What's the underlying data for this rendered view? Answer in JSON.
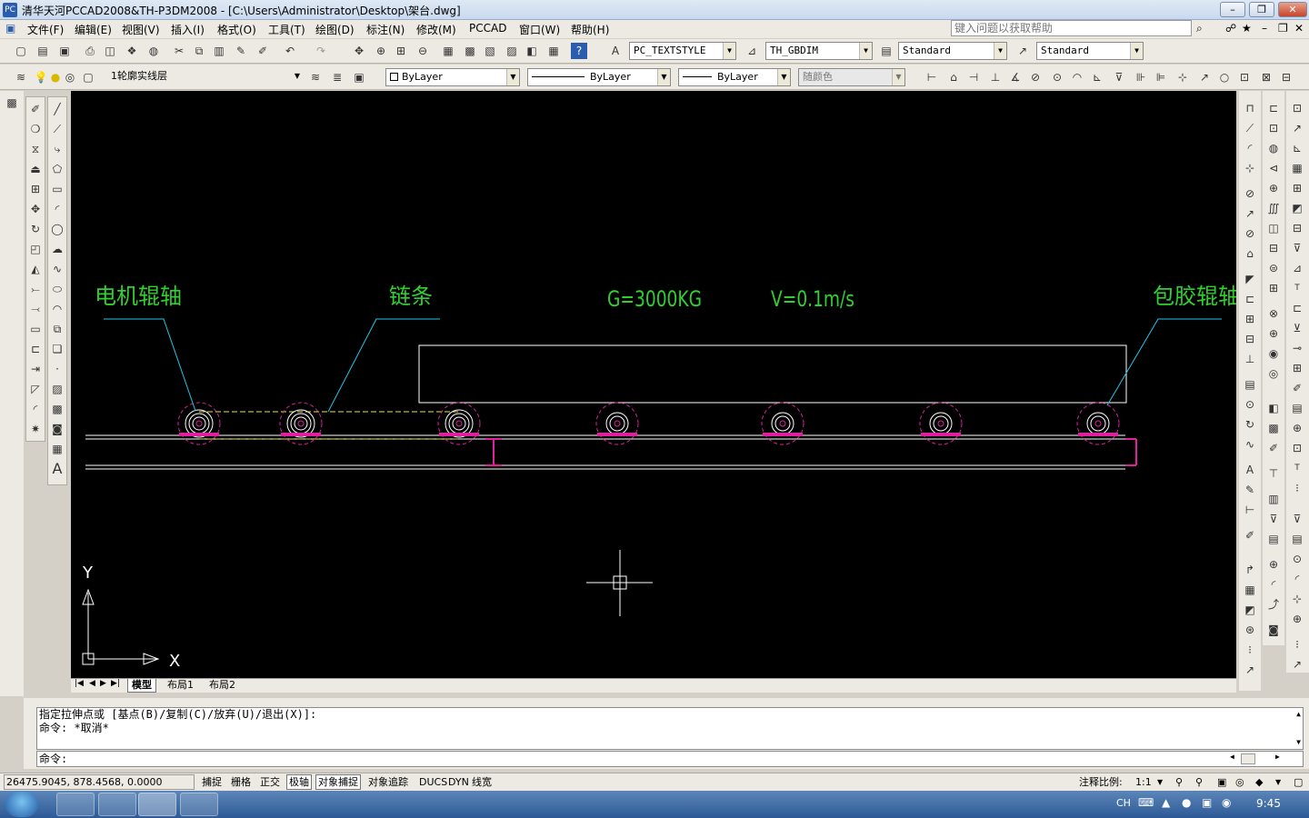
{
  "titlebar": {
    "title": "清华天河PCCAD2008&TH-P3DM2008 - [C:\\Users\\Administrator\\Desktop\\架台.dwg]"
  },
  "menu": [
    "文件(F)",
    "编辑(E)",
    "视图(V)",
    "插入(I)",
    "格式(O)",
    "工具(T)",
    "绘图(D)",
    "标注(N)",
    "修改(M)",
    "PCCAD",
    "窗口(W)",
    "帮助(H)"
  ],
  "help_placeholder": "键入问题以获取帮助",
  "toolbar": {
    "text_style": "PC_TEXTSTYLE",
    "dim_style": "TH_GBDIM",
    "table_style": "Standard",
    "multileader_style": "Standard",
    "layer": "1轮廓实线层",
    "color": "ByLayer",
    "linetype": "ByLayer",
    "lineweight": "ByLayer",
    "plotstyle": "随颜色"
  },
  "drawing": {
    "label_motor": "电机辊轴",
    "label_chain": "链条",
    "label_load": "G=3000KG",
    "label_speed": "V=0.1m/s",
    "label_rubber": "包胶辊轴",
    "ucs_x": "X",
    "ucs_y": "Y",
    "colors": {
      "text": "#2fd02f",
      "leader": "#1ec8e8",
      "rollers": "#e0209f",
      "lines": "#ffffff",
      "chain": "#e8e060"
    }
  },
  "tabs": [
    "模型",
    "布局1",
    "布局2"
  ],
  "command": {
    "line1": "指定拉伸点或 [基点(B)/复制(C)/放弃(U)/退出(X)]:",
    "line2": "命令: *取消*",
    "prompt": "命令:"
  },
  "status": {
    "coords": "26475.9045, 878.4568, 0.0000",
    "toggles": [
      {
        "label": "捕捉",
        "on": false
      },
      {
        "label": "栅格",
        "on": false
      },
      {
        "label": "正交",
        "on": false
      },
      {
        "label": "极轴",
        "on": true
      },
      {
        "label": "对象捕捉",
        "on": true
      },
      {
        "label": "对象追踪",
        "on": false
      },
      {
        "label": "DUCS",
        "on": false
      },
      {
        "label": "DYN",
        "on": false
      },
      {
        "label": "线宽",
        "on": false
      }
    ],
    "scale_label": "注释比例:",
    "scale_value": "1:1"
  },
  "taskbar": {
    "ime": "CH",
    "clock": "9:45"
  }
}
